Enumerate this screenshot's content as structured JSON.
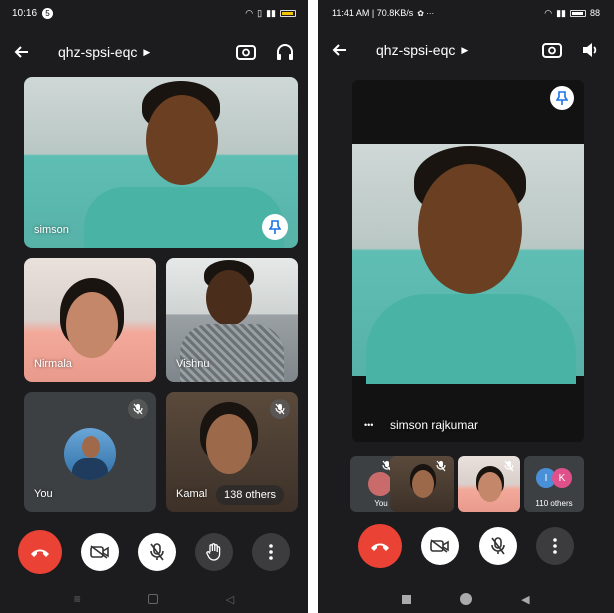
{
  "left": {
    "status": {
      "time": "10:16",
      "notif_count": "5"
    },
    "meeting_code": "qhz-spsi-eqc",
    "tiles": {
      "main_name": "simson",
      "tile2_name": "Nirmala",
      "tile3_name": "Vishnu",
      "tile4_name": "You",
      "tile5_name": "Kamal",
      "others": "138 others"
    }
  },
  "right": {
    "status": {
      "time": "11:41 AM | 70.8KB/s",
      "battery": "88"
    },
    "meeting_code": "qhz-spsi-eqc",
    "main_name": "simson rajkumar",
    "more_dots": "•••",
    "thumb_you": "You",
    "thumb_others": "110 others",
    "avatar_i": "I",
    "avatar_k": "K",
    "avatar_i_color": "#4a90d9",
    "avatar_k_color": "#e0508a"
  },
  "colors": {
    "end_call": "#ea4335",
    "panel": "#1c1c1e",
    "tile": "#3c4043"
  },
  "icons": [
    "back-arrow-icon",
    "chevron-right-icon",
    "switch-camera-icon",
    "headphones-icon",
    "speaker-icon",
    "pin-icon",
    "mic-off-icon",
    "camera-off-icon",
    "raise-hand-icon",
    "more-vert-icon",
    "end-call-icon"
  ]
}
